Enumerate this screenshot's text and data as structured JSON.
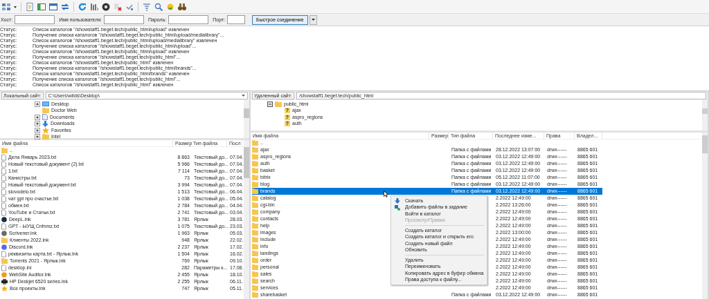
{
  "quickconnect": {
    "fields": [
      {
        "label": "Хост:"
      },
      {
        "label": "Имя пользователя:"
      },
      {
        "label": "Пароль:"
      },
      {
        "label": "Порт:"
      }
    ],
    "button": "Быстрое соединение"
  },
  "log": [
    {
      "label": "Статус:",
      "message": "Список каталогов \"/showstaff1.beget.tech/public_html/upload\" извлечен"
    },
    {
      "label": "Статус:",
      "message": "Получение списка каталогов \"/showstaff1.beget.tech/public_html/upload/medialibrary\"..."
    },
    {
      "label": "Статус:",
      "message": "Список каталогов \"/showstaff1.beget.tech/public_html/upload/medialibrary\" извлечен"
    },
    {
      "label": "Статус:",
      "message": "Получение списка каталогов \"/showstaff1.beget.tech/public_html/upload\"..."
    },
    {
      "label": "Статус:",
      "message": "Список каталогов \"/showstaff1.beget.tech/public_html/upload\" извлечен"
    },
    {
      "label": "Статус:",
      "message": "Получение списка каталогов \"/showstaff1.beget.tech/public_html\"..."
    },
    {
      "label": "Статус:",
      "message": "Список каталогов \"/showstaff1.beget.tech/public_html\" извлечен"
    },
    {
      "label": "Статус:",
      "message": "Получение списка каталогов \"/showstaff1.beget.tech/public_html/brands\"..."
    },
    {
      "label": "Статус:",
      "message": "Список каталогов \"/showstaff1.beget.tech/public_html/brands\" извлечен"
    },
    {
      "label": "Статус:",
      "message": "Получение списка каталогов \"/showstaff1.beget.tech/public_html\"..."
    },
    {
      "label": "Статус:",
      "message": "Список каталогов \"/showstaff1.beget.tech/public_html\" извлечен"
    }
  ],
  "local": {
    "label": "Локальный сайт:",
    "path": "C:\\Users\\wilds\\Desktop\\",
    "tree": [
      {
        "name": "Desktop",
        "kind": "desktop",
        "expanded": false
      },
      {
        "name": "Doctor Web",
        "kind": "folder"
      },
      {
        "name": "Documents",
        "kind": "documents",
        "expanded": false
      },
      {
        "name": "Downloads",
        "kind": "downloads",
        "expanded": false
      },
      {
        "name": "Favorites",
        "kind": "favorites",
        "expanded": false
      },
      {
        "name": "Intel",
        "kind": "folder",
        "expanded": false
      }
    ],
    "columns": [
      "Имя файла",
      "Размер",
      "Тип файла",
      "Посл"
    ],
    "rows": [
      {
        "name": "..",
        "kind": "folder",
        "selected": false
      },
      {
        "name": "Дела Январь 2023.txt",
        "kind": "file",
        "size": "8 863",
        "type": "Текстовый до...",
        "modified": "07.04.",
        "selected": false
      },
      {
        "name": "Новый текстовый документ (2).txt",
        "kind": "file",
        "size": "5 966",
        "type": "Текстовый до...",
        "modified": "07.04.",
        "selected": false
      },
      {
        "name": "1.txt",
        "kind": "file",
        "size": "7 114",
        "type": "Текстовый до...",
        "modified": "07.04.",
        "selected": false
      },
      {
        "name": "Канистры.txt",
        "kind": "file",
        "size": "73",
        "type": "Текстовый до...",
        "modified": "07.04.",
        "selected": false
      },
      {
        "name": "Новый текстовый документ.txt",
        "kind": "file",
        "size": "3 994",
        "type": "Текстовый до...",
        "modified": "07.04.",
        "selected": false
      },
      {
        "name": "slovodelo.txt",
        "kind": "file",
        "size": "1 513",
        "type": "Текстовый до...",
        "modified": "06.04.",
        "selected": false
      },
      {
        "name": "чат gpt про счастье.txt",
        "kind": "file",
        "size": "1 038",
        "type": "Текстовый до...",
        "modified": "05.04.",
        "selected": false
      },
      {
        "name": "обмен.txt",
        "kind": "file",
        "size": "2 784",
        "type": "Текстовый до...",
        "modified": "04.04.",
        "selected": false
      },
      {
        "name": "YouTube и Статьи.txt",
        "kind": "file",
        "size": "2 741",
        "type": "Текстовый до...",
        "modified": "03.04.",
        "selected": false
      },
      {
        "name": "DeepL.lnk",
        "kind": "app",
        "color": "#1b2a4a",
        "size": "3 781",
        "type": "Ярлык",
        "modified": "28.03.",
        "selected": false
      },
      {
        "name": "GPT - ЫУЩ Cnfnmz.txt",
        "kind": "file",
        "size": "1 075",
        "type": "Текстовый до...",
        "modified": "23.03.",
        "selected": false
      },
      {
        "name": "Scrivener.lnk",
        "kind": "app",
        "color": "#6a6a6a",
        "size": "1 963",
        "type": "Ярлык",
        "modified": "05.03.",
        "selected": false
      },
      {
        "name": "Клиенты 2022.lnk",
        "kind": "folder",
        "size": "948",
        "type": "Ярлык",
        "modified": "22.02.",
        "selected": false
      },
      {
        "name": "Discord.lnk",
        "kind": "app",
        "color": "#5865f2",
        "size": "2 237",
        "type": "Ярлык",
        "modified": "17.02.",
        "selected": false
      },
      {
        "name": "реквизиты карта.txt - Ярлык.lnk",
        "kind": "file",
        "size": "1 504",
        "type": "Ярлык",
        "modified": "16.02.",
        "selected": false
      },
      {
        "name": "Torrents 2021 - Ярлык.lnk",
        "kind": "folder",
        "size": "769",
        "type": "Ярлык",
        "modified": "09.10.",
        "selected": false
      },
      {
        "name": "desktop.ini",
        "kind": "file",
        "size": "282",
        "type": "Параметры к...",
        "modified": "17.08.",
        "selected": false
      },
      {
        "name": "WebSite Auditor.lnk",
        "kind": "app",
        "color": "#f29b1d",
        "size": "2 455",
        "type": "Ярлык",
        "modified": "18.10.",
        "selected": false
      },
      {
        "name": "HP Deskjet 6520 series.lnk",
        "kind": "printer",
        "size": "2 255",
        "type": "Ярлык",
        "modified": "06.11.",
        "selected": false
      },
      {
        "name": "Все проекты.lnk",
        "kind": "star",
        "size": "747",
        "type": "Ярлык",
        "modified": "05.11.",
        "selected": false
      }
    ]
  },
  "remote": {
    "label": "Удаленный сайт:",
    "path": "/showstaff1.beget.tech/public_html",
    "tree": [
      {
        "name": "public_html",
        "kind": "folder",
        "expanded": true,
        "children": [
          {
            "name": "ajax",
            "kind": "unknown",
            "mark": "?"
          },
          {
            "name": "aspro_regions",
            "kind": "unknown",
            "mark": "?"
          },
          {
            "name": "auth",
            "kind": "unknown",
            "mark": "?"
          }
        ]
      }
    ],
    "columns": [
      "Имя файла",
      "Размер",
      "Тип файла",
      "Последнее изме...",
      "Права",
      "Владел..."
    ],
    "rows": [
      {
        "name": "..",
        "kind": "folder",
        "selected": false
      },
      {
        "name": "ajax",
        "kind": "folder",
        "type": "Папка с файлами",
        "modified": "28.12.2022 13:07:00",
        "rights": "drwx------",
        "owner": "8865 601",
        "selected": false
      },
      {
        "name": "aspro_regions",
        "kind": "folder",
        "type": "Папка с файлами",
        "modified": "03.12.2022 12:49:00",
        "rights": "drwx------",
        "owner": "8865 601",
        "selected": false
      },
      {
        "name": "auth",
        "kind": "folder",
        "type": "Папка с файлами",
        "modified": "03.12.2022 12:49:00",
        "rights": "drwx------",
        "owner": "8865 601",
        "selected": false
      },
      {
        "name": "basket",
        "kind": "folder",
        "type": "Папка с файлами",
        "modified": "03.12.2022 12:49:00",
        "rights": "drwx------",
        "owner": "8865 601",
        "selected": false
      },
      {
        "name": "bitrix",
        "kind": "folder",
        "type": "Папка с файлами",
        "modified": "05.12.2022 11:07:00",
        "rights": "drwx------",
        "owner": "8865 601",
        "selected": false
      },
      {
        "name": "blog",
        "kind": "folder",
        "type": "Папка с файлами",
        "modified": "03.12.2022 12:49:00",
        "rights": "drwx------",
        "owner": "8865 601",
        "selected": false
      },
      {
        "name": "brands",
        "kind": "folder",
        "type": "Папка с файлами",
        "modified": "03.12.2022 12:49:00",
        "rights": "drwx------",
        "owner": "8865 601",
        "selected": true
      },
      {
        "name": "catalog",
        "kind": "folder",
        "modified": "2.2022 12:49:00",
        "rights": "drwx------",
        "owner": "8865 601",
        "selected": false
      },
      {
        "name": "cgi-bin",
        "kind": "folder",
        "modified": "2.2022 13:26:00",
        "rights": "drwx------",
        "owner": "8865 601",
        "selected": false
      },
      {
        "name": "company",
        "kind": "folder",
        "modified": "2.2022 12:49:00",
        "rights": "drwx------",
        "owner": "8865 601",
        "selected": false
      },
      {
        "name": "contacts",
        "kind": "folder",
        "modified": "2.2022 12:49:00",
        "rights": "drwx------",
        "owner": "8865 601",
        "selected": false
      },
      {
        "name": "help",
        "kind": "folder",
        "modified": "2.2022 12:49:00",
        "rights": "drwx------",
        "owner": "8865 601",
        "selected": false
      },
      {
        "name": "images",
        "kind": "folder",
        "modified": "2.2022 13:00:00",
        "rights": "drwx------",
        "owner": "8865 601",
        "selected": false
      },
      {
        "name": "include",
        "kind": "folder",
        "modified": "2.2022 12:49:00",
        "rights": "drwx------",
        "owner": "8865 601",
        "selected": false
      },
      {
        "name": "info",
        "kind": "folder",
        "modified": "2.2022 12:49:00",
        "rights": "drwx------",
        "owner": "8865 601",
        "selected": false
      },
      {
        "name": "landings",
        "kind": "folder",
        "modified": "2.2022 12:49:00",
        "rights": "drwx------",
        "owner": "8865 601",
        "selected": false
      },
      {
        "name": "order",
        "kind": "folder",
        "modified": "2.2022 12:49:00",
        "rights": "drwx------",
        "owner": "8865 601",
        "selected": false
      },
      {
        "name": "personal",
        "kind": "folder",
        "modified": "2.2022 12:49:00",
        "rights": "drwx------",
        "owner": "8865 601",
        "selected": false
      },
      {
        "name": "sales",
        "kind": "folder",
        "modified": "2.2022 12:49:00",
        "rights": "drwx------",
        "owner": "8865 601",
        "selected": false
      },
      {
        "name": "search",
        "kind": "folder",
        "modified": "2.2022 12:49:00",
        "rights": "drwx------",
        "owner": "8865 601",
        "selected": false
      },
      {
        "name": "services",
        "kind": "folder",
        "modified": "2.2022 12:49:00",
        "rights": "drwx------",
        "owner": "8865 601",
        "selected": false
      },
      {
        "name": "sharebasket",
        "kind": "folder",
        "type": "Папка с файлами",
        "modified": "03.12.2022 12:49:00",
        "rights": "drwx------",
        "owner": "8865 601",
        "selected": false
      }
    ]
  },
  "context_menu": {
    "items": [
      {
        "kind": "download",
        "label": "Скачать",
        "disabled": false
      },
      {
        "kind": "queue",
        "label": "Добавить файлы в задание",
        "disabled": false
      },
      {
        "kind": "item",
        "label": "Войти в каталог",
        "disabled": false
      },
      {
        "kind": "item",
        "label": "Просмотр/Правка",
        "disabled": true
      },
      {
        "kind": "separator"
      },
      {
        "kind": "item",
        "label": "Создать каталог",
        "disabled": false
      },
      {
        "kind": "item",
        "label": "Создать каталог и открыть его",
        "disabled": false
      },
      {
        "kind": "item",
        "label": "Создать новый файл",
        "disabled": false
      },
      {
        "kind": "item",
        "label": "Обновить",
        "disabled": false
      },
      {
        "kind": "separator"
      },
      {
        "kind": "item",
        "label": "Удалить",
        "disabled": false
      },
      {
        "kind": "item",
        "label": "Переименовать",
        "disabled": false
      },
      {
        "kind": "item",
        "label": "Копировать адрес в буфер обмена",
        "disabled": false
      },
      {
        "kind": "item",
        "label": "Права доступа к файлу...",
        "disabled": false
      }
    ]
  }
}
